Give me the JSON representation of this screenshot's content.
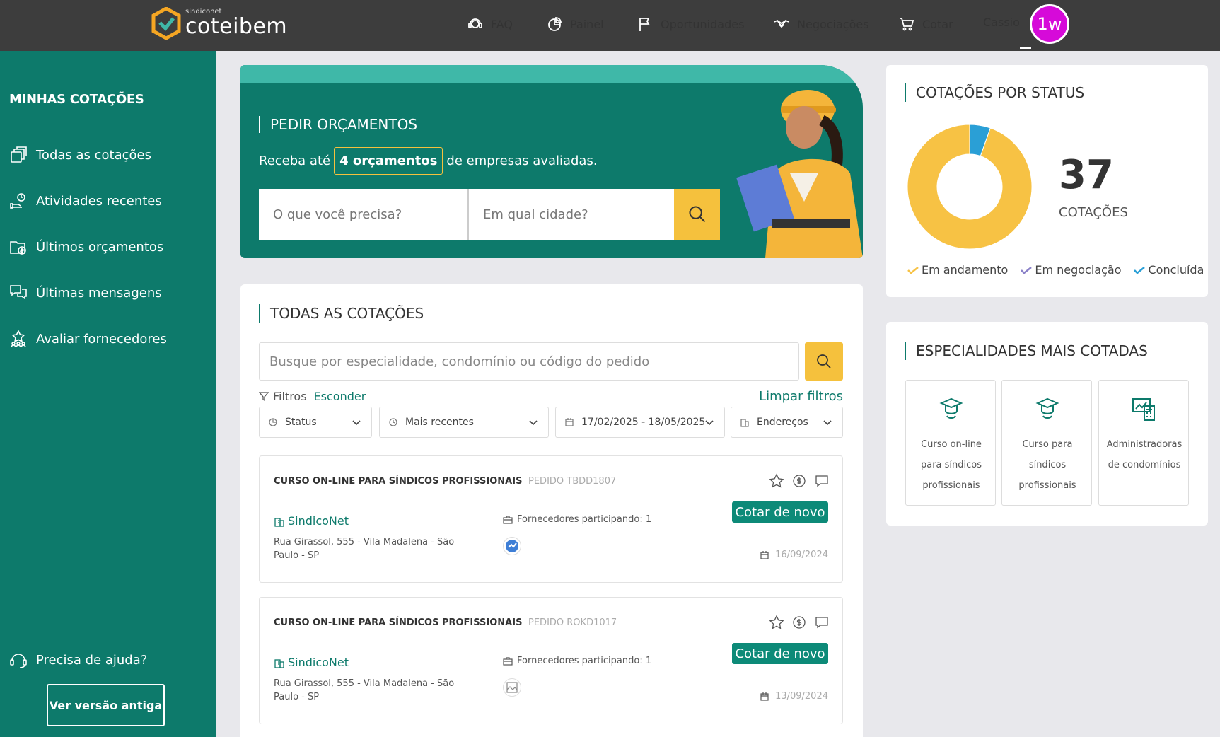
{
  "topbar": {
    "logo_small": "sindiconet",
    "logo_big": "coteibem",
    "nav": [
      {
        "label": "FAQ",
        "icon": "support-icon"
      },
      {
        "label": "Painel",
        "icon": "pie-chart-icon"
      },
      {
        "label": "Oportunidades",
        "icon": "flag-icon"
      },
      {
        "label": "Negociações",
        "icon": "handshake-icon"
      },
      {
        "label": "Cotar",
        "icon": "cart-icon"
      }
    ],
    "user_name": "Cassio",
    "avatar_initials": "1w",
    "avatar_color": "#d60ad9"
  },
  "sidebar": {
    "title": "MINHAS COTAÇÕES",
    "items": [
      {
        "label": "Todas as cotações",
        "icon": "documents-icon"
      },
      {
        "label": "Atividades recentes",
        "icon": "activity-icon"
      },
      {
        "label": "Últimos orçamentos",
        "icon": "budget-folder-icon"
      },
      {
        "label": "Últimas mensagens",
        "icon": "messages-icon"
      },
      {
        "label": "Avaliar fornecedores",
        "icon": "rating-icon"
      }
    ],
    "help_label": "Precisa de ajuda?",
    "old_version_label": "Ver versão antiga"
  },
  "hero": {
    "title": "PEDIR ORÇAMENTOS",
    "subtitle_before": "Receba até",
    "subtitle_highlight": "4 orçamentos",
    "subtitle_after": "de empresas avaliadas.",
    "what_placeholder": "O que você precisa?",
    "city_placeholder": "Em qual cidade?"
  },
  "quotes": {
    "title": "TODAS AS COTAÇÕES",
    "search_placeholder": "Busque por especialidade, condomínio ou código do pedido",
    "filters_label": "Filtros",
    "filters_hide": "Esconder",
    "filters_clear": "Limpar filtros",
    "dropdowns": {
      "status": "Status",
      "sort": "Mais recentes",
      "dates": "17/02/2025 - 18/05/2025",
      "address": "Endereços"
    },
    "orders": [
      {
        "title": "CURSO ON-LINE PARA SÍNDICOS PROFISSIONAIS",
        "code": "PEDIDO TBDD1807",
        "button": "Cotar de novo",
        "company": "SindicoNet",
        "address": "Rua Girassol, 555 - Vila Madalena - São Paulo - SP",
        "suppliers": "Fornecedores participando: 1",
        "date": "16/09/2024"
      },
      {
        "title": "CURSO ON-LINE PARA SÍNDICOS PROFISSIONAIS",
        "code": "PEDIDO ROKD1017",
        "button": "Cotar de novo",
        "company": "SindicoNet",
        "address": "Rua Girassol, 555 - Vila Madalena - São Paulo - SP",
        "suppliers": "Fornecedores participando: 1",
        "date": "13/09/2024"
      }
    ]
  },
  "status_card": {
    "title": "COTAÇÕES POR STATUS",
    "total": "37",
    "total_label": "COTAÇÕES",
    "legend": [
      {
        "label": "Em andamento",
        "color": "#f7c244"
      },
      {
        "label": "Em negociação",
        "color": "#8a80c8"
      },
      {
        "label": "Concluída",
        "color": "#2a9fd6"
      }
    ],
    "chart_data": {
      "type": "pie",
      "labels": [
        "Em andamento",
        "Em negociação",
        "Concluída"
      ],
      "values": [
        35,
        0,
        2
      ],
      "colors": [
        "#f7c244",
        "#8a80c8",
        "#2a9fd6"
      ]
    }
  },
  "specialties": {
    "title": "ESPECIALIDADES MAIS COTADAS",
    "items": [
      {
        "label": "Curso on-line para síndicos profissionais",
        "icon": "graduate-icon"
      },
      {
        "label": "Curso para síndicos profissionais",
        "icon": "graduate-icon"
      },
      {
        "label": "Administradoras de condomínios",
        "icon": "building-admin-icon"
      }
    ]
  },
  "colors": {
    "primary": "#0d7a6b",
    "accent": "#f5c13d",
    "topbar": "#3d3d3d"
  }
}
